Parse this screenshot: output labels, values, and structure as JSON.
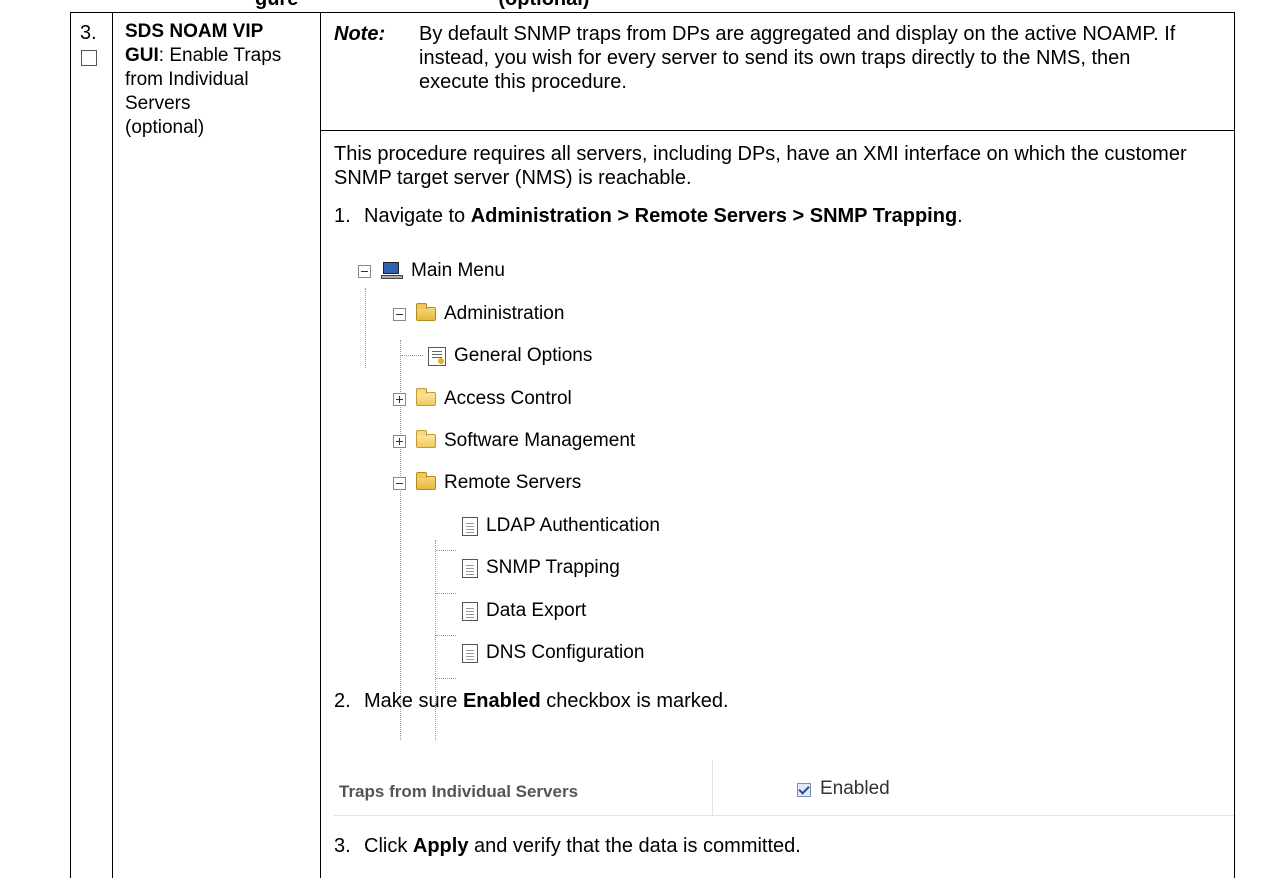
{
  "header_fragment": "gure                                    (optional)",
  "step": {
    "number": "3."
  },
  "left": {
    "title_bold": "SDS NOAM VIP GUI",
    "title_rest": ": Enable Traps from Individual Servers",
    "optional": "(optional)"
  },
  "note": {
    "label": "Note:",
    "text": "By default SNMP traps from DPs are aggregated and display on the active NOAMP.  If instead, you wish for every server to send its own traps directly to the NMS, then execute this procedure."
  },
  "paragraph": "This procedure requires all servers, including DPs, have an XMI interface on which the customer SNMP target server (NMS) is reachable.",
  "step1": {
    "num": "1.",
    "prefix": "Navigate to ",
    "path": "Administration > Remote Servers > SNMP Trapping",
    "suffix": "."
  },
  "tree": {
    "main_menu": "Main Menu",
    "administration": "Administration",
    "general_options": "General Options",
    "access_control": "Access Control",
    "software_management": "Software Management",
    "remote_servers": "Remote Servers",
    "ldap_authentication": "LDAP Authentication",
    "snmp_trapping": "SNMP Trapping",
    "data_export": "Data Export",
    "dns_configuration": "DNS Configuration"
  },
  "step2": {
    "num": "2.",
    "prefix": "Make sure ",
    "bold": "Enabled",
    "suffix": " checkbox is marked."
  },
  "form": {
    "label": "Traps from Individual Servers",
    "checkbox_label": "Enabled",
    "checked": true
  },
  "step3": {
    "num": "3.",
    "prefix": "Click ",
    "bold": "Apply",
    "suffix": " and verify that the data is committed."
  }
}
